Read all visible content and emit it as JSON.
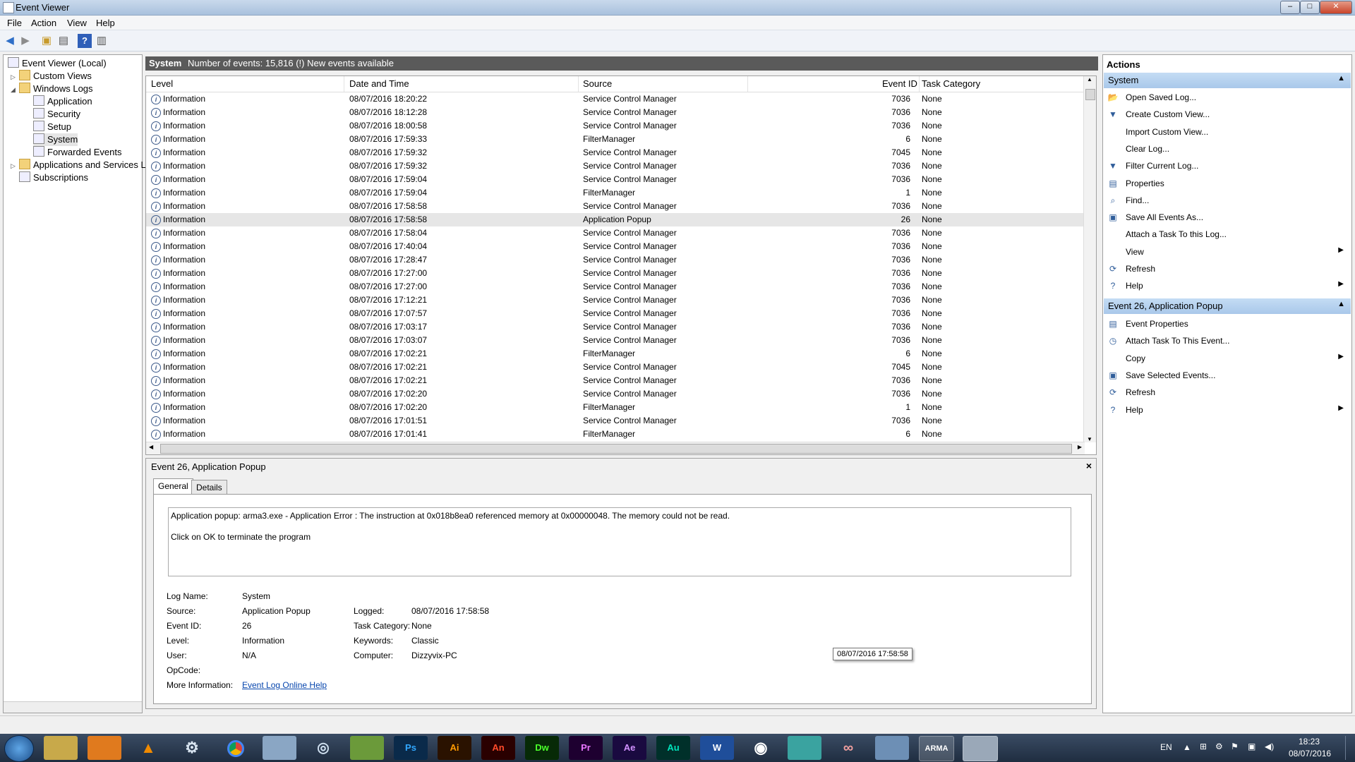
{
  "window": {
    "title": "Event Viewer"
  },
  "menu": [
    "File",
    "Action",
    "View",
    "Help"
  ],
  "tree": {
    "root": "Event Viewer (Local)",
    "custom_views": "Custom Views",
    "windows_logs": "Windows Logs",
    "logs": [
      "Application",
      "Security",
      "Setup",
      "System",
      "Forwarded Events"
    ],
    "apps_services": "Applications and Services Lo",
    "subscriptions": "Subscriptions"
  },
  "center": {
    "log_name": "System",
    "summary": "Number of events: 15,816 (!) New events available"
  },
  "grid": {
    "columns": [
      "Level",
      "Date and Time",
      "Source",
      "Event ID",
      "Task Category"
    ],
    "rows": [
      [
        "Information",
        "08/07/2016 18:20:22",
        "Service Control Manager",
        "7036",
        "None"
      ],
      [
        "Information",
        "08/07/2016 18:12:28",
        "Service Control Manager",
        "7036",
        "None"
      ],
      [
        "Information",
        "08/07/2016 18:00:58",
        "Service Control Manager",
        "7036",
        "None"
      ],
      [
        "Information",
        "08/07/2016 17:59:33",
        "FilterManager",
        "6",
        "None"
      ],
      [
        "Information",
        "08/07/2016 17:59:32",
        "Service Control Manager",
        "7045",
        "None"
      ],
      [
        "Information",
        "08/07/2016 17:59:32",
        "Service Control Manager",
        "7036",
        "None"
      ],
      [
        "Information",
        "08/07/2016 17:59:04",
        "Service Control Manager",
        "7036",
        "None"
      ],
      [
        "Information",
        "08/07/2016 17:59:04",
        "FilterManager",
        "1",
        "None"
      ],
      [
        "Information",
        "08/07/2016 17:58:58",
        "Service Control Manager",
        "7036",
        "None"
      ],
      [
        "Information",
        "08/07/2016 17:58:58",
        "Application Popup",
        "26",
        "None"
      ],
      [
        "Information",
        "08/07/2016 17:58:04",
        "Service Control Manager",
        "7036",
        "None"
      ],
      [
        "Information",
        "08/07/2016 17:40:04",
        "Service Control Manager",
        "7036",
        "None"
      ],
      [
        "Information",
        "08/07/2016 17:28:47",
        "Service Control Manager",
        "7036",
        "None"
      ],
      [
        "Information",
        "08/07/2016 17:27:00",
        "Service Control Manager",
        "7036",
        "None"
      ],
      [
        "Information",
        "08/07/2016 17:27:00",
        "Service Control Manager",
        "7036",
        "None"
      ],
      [
        "Information",
        "08/07/2016 17:12:21",
        "Service Control Manager",
        "7036",
        "None"
      ],
      [
        "Information",
        "08/07/2016 17:07:57",
        "Service Control Manager",
        "7036",
        "None"
      ],
      [
        "Information",
        "08/07/2016 17:03:17",
        "Service Control Manager",
        "7036",
        "None"
      ],
      [
        "Information",
        "08/07/2016 17:03:07",
        "Service Control Manager",
        "7036",
        "None"
      ],
      [
        "Information",
        "08/07/2016 17:02:21",
        "FilterManager",
        "6",
        "None"
      ],
      [
        "Information",
        "08/07/2016 17:02:21",
        "Service Control Manager",
        "7045",
        "None"
      ],
      [
        "Information",
        "08/07/2016 17:02:21",
        "Service Control Manager",
        "7036",
        "None"
      ],
      [
        "Information",
        "08/07/2016 17:02:20",
        "Service Control Manager",
        "7036",
        "None"
      ],
      [
        "Information",
        "08/07/2016 17:02:20",
        "FilterManager",
        "1",
        "None"
      ],
      [
        "Information",
        "08/07/2016 17:01:51",
        "Service Control Manager",
        "7036",
        "None"
      ],
      [
        "Information",
        "08/07/2016 17:01:41",
        "FilterManager",
        "6",
        "None"
      ]
    ],
    "selected_row": 9
  },
  "detail": {
    "title": "Event 26, Application Popup",
    "close": "×",
    "tabs": [
      "General",
      "Details"
    ],
    "message_line1": "Application popup: arma3.exe - Application Error : The instruction at 0x018b8ea0 referenced memory at 0x00000048. The memory could not be read.",
    "message_line2": "Click on OK to terminate the program",
    "labels": {
      "log_name": "Log Name:",
      "source": "Source:",
      "event_id": "Event ID:",
      "level": "Level:",
      "user": "User:",
      "opcode": "OpCode:",
      "more_info": "More Information:",
      "logged": "Logged:",
      "task_category": "Task Category:",
      "keywords": "Keywords:",
      "computer": "Computer:"
    },
    "values": {
      "log_name": "System",
      "source": "Application Popup",
      "event_id": "26",
      "level": "Information",
      "user": "N/A",
      "opcode": "",
      "more_info_link": "Event Log Online Help",
      "logged": "08/07/2016 17:58:58",
      "task_category": "None",
      "keywords": "Classic",
      "computer": "Dizzyvix-PC"
    },
    "tooltip": "08/07/2016 17:58:58"
  },
  "actions": {
    "header": "Actions",
    "section1": "System",
    "items1": [
      "Open Saved Log...",
      "Create Custom View...",
      "Import Custom View...",
      "Clear Log...",
      "Filter Current Log...",
      "Properties",
      "Find...",
      "Save All Events As...",
      "Attach a Task To this Log...",
      "View",
      "Refresh",
      "Help"
    ],
    "section2": "Event 26, Application Popup",
    "items2": [
      "Event Properties",
      "Attach Task To This Event...",
      "Copy",
      "Save Selected Events...",
      "Refresh",
      "Help"
    ]
  },
  "taskbar": {
    "apps": [
      "Ps",
      "Ai",
      "An",
      "Dw",
      "Pr",
      "Ae",
      "Au",
      "W"
    ],
    "lang": "EN",
    "time": "18:23",
    "date": "08/07/2016"
  }
}
